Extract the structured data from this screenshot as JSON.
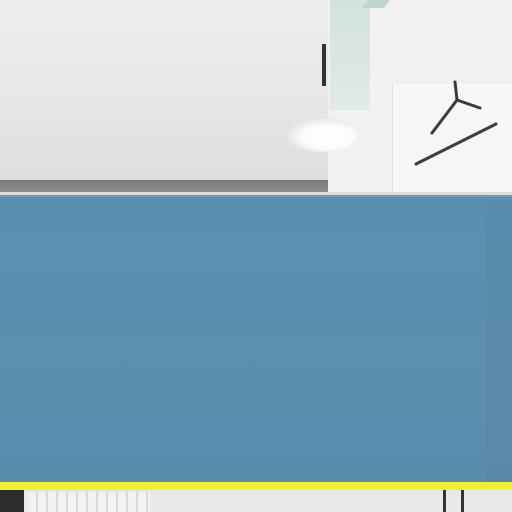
{
  "scene": {
    "lamp_icon": "ceiling-lamp-icon",
    "hanger_icon": "coat-hanger-icon"
  },
  "overlay": {
    "color": "#5b8fb1"
  },
  "progress": {
    "fill_color": "#f2ef2c",
    "value_percent": 100
  }
}
